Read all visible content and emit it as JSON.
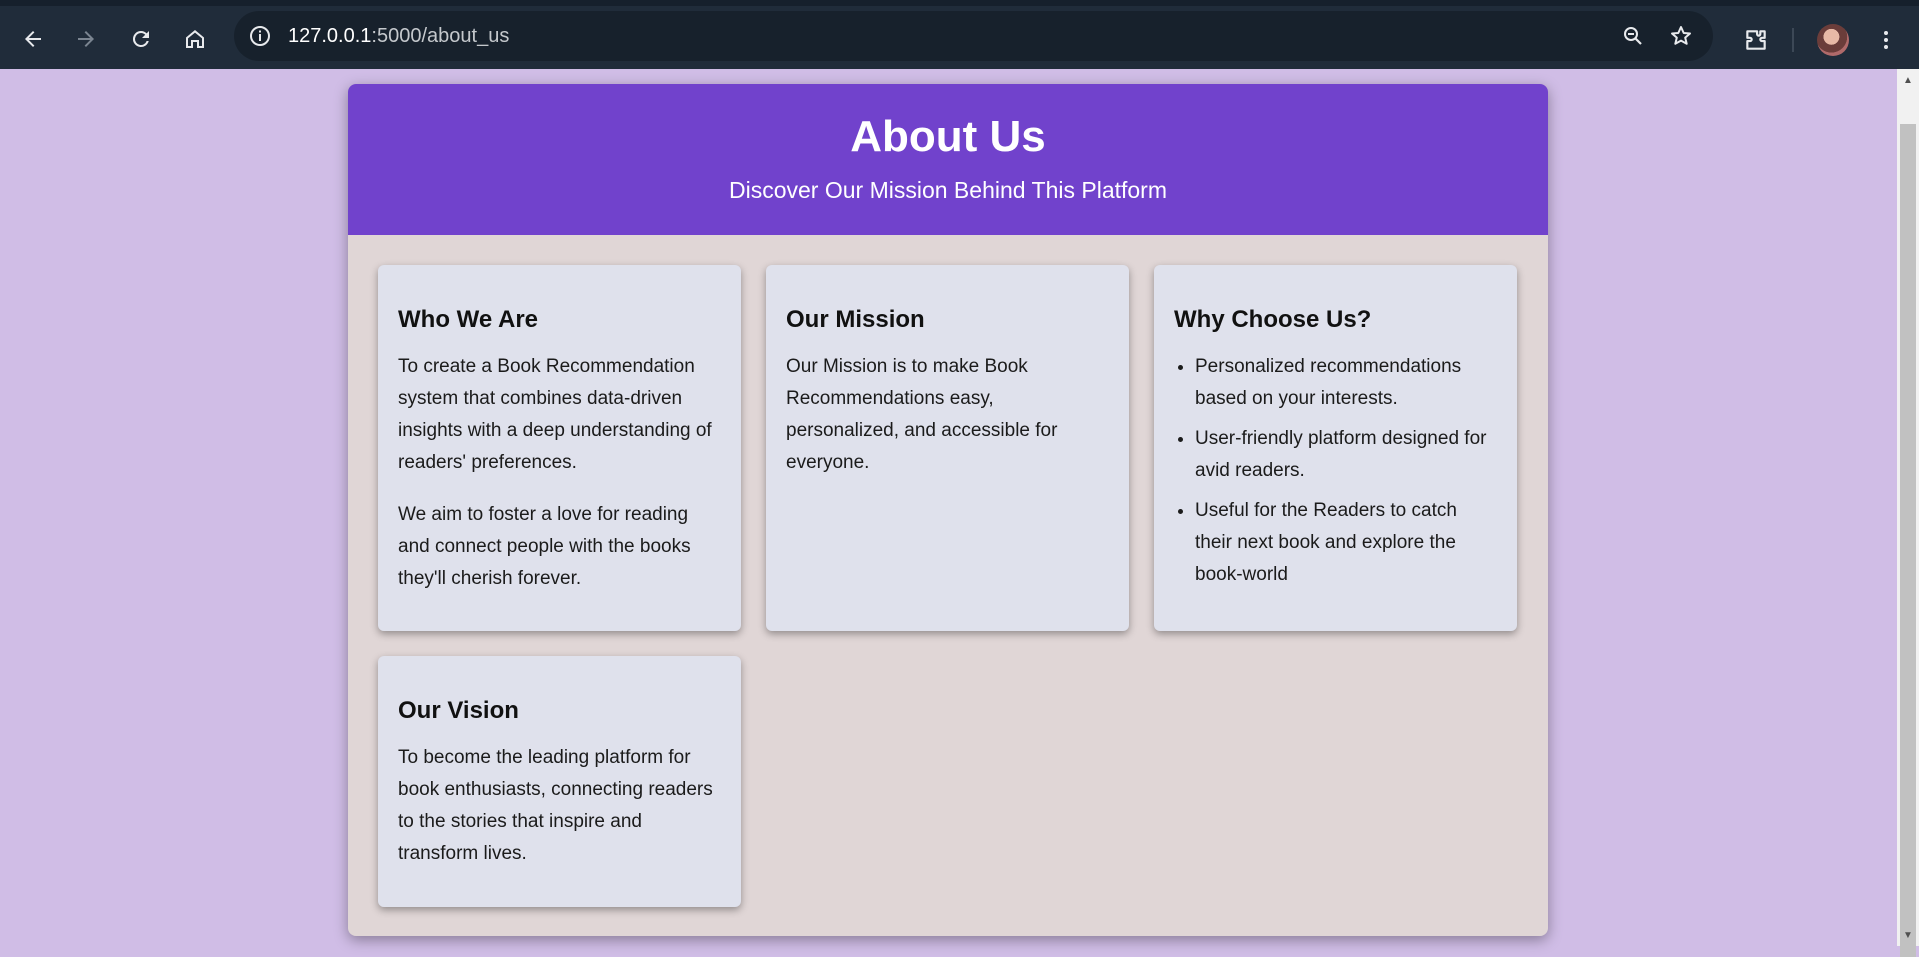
{
  "browser": {
    "url_host": "127.0.0.1",
    "url_path": ":5000/about_us"
  },
  "hero": {
    "title": "About Us",
    "subtitle": "Discover Our Mission Behind This Platform"
  },
  "cards": {
    "who": {
      "title": "Who We Are",
      "p1": "To create a Book Recommendation system that combines data-driven insights with a deep understanding of readers' preferences.",
      "p2": "We aim to foster a love for reading and connect people with the books they'll cherish forever."
    },
    "mission": {
      "title": "Our Mission",
      "p1": "Our Mission is to make Book Recommendations easy, personalized, and accessible for everyone."
    },
    "why": {
      "title": "Why Choose Us?",
      "items": [
        "Personalized recommendations based on your interests.",
        "User-friendly platform designed for avid readers.",
        "Useful for the Readers to catch their next book and explore the book-world"
      ]
    },
    "vision": {
      "title": "Our Vision",
      "p1": "To become the leading platform for book enthusiasts, connecting readers to the stories that inspire and transform lives."
    }
  },
  "icons": {
    "back": "back-arrow-icon",
    "forward": "forward-arrow-icon",
    "reload": "reload-icon",
    "home": "home-icon",
    "info": "info-icon",
    "zoom": "zoom-icon",
    "bookmark": "star-icon",
    "extensions": "puzzle-icon",
    "menu": "kebab-menu-icon"
  },
  "colors": {
    "page_bg": "#d0bde6",
    "hero_bg": "#7142cc",
    "card_bg": "#dfe1ec",
    "container_bg": "#e0d6d6"
  }
}
